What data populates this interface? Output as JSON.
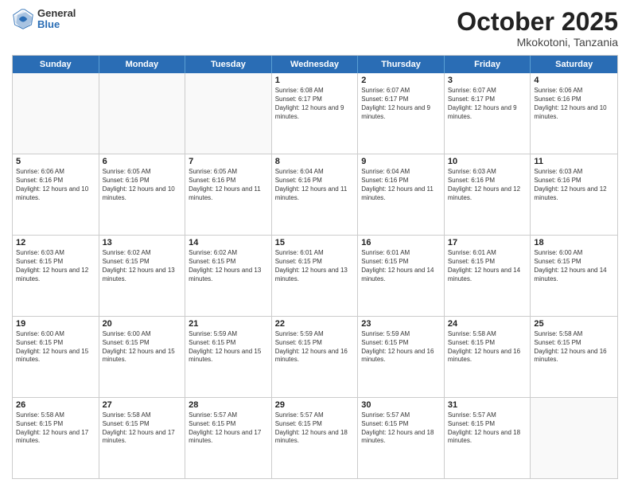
{
  "header": {
    "logo": {
      "general": "General",
      "blue": "Blue"
    },
    "title": "October 2025",
    "subtitle": "Mkokotoni, Tanzania"
  },
  "calendar": {
    "days_of_week": [
      "Sunday",
      "Monday",
      "Tuesday",
      "Wednesday",
      "Thursday",
      "Friday",
      "Saturday"
    ],
    "weeks": [
      [
        {
          "day": "",
          "empty": true
        },
        {
          "day": "",
          "empty": true
        },
        {
          "day": "",
          "empty": true
        },
        {
          "day": "1",
          "sunrise": "6:08 AM",
          "sunset": "6:17 PM",
          "daylight": "12 hours and 9 minutes."
        },
        {
          "day": "2",
          "sunrise": "6:07 AM",
          "sunset": "6:17 PM",
          "daylight": "12 hours and 9 minutes."
        },
        {
          "day": "3",
          "sunrise": "6:07 AM",
          "sunset": "6:17 PM",
          "daylight": "12 hours and 9 minutes."
        },
        {
          "day": "4",
          "sunrise": "6:06 AM",
          "sunset": "6:16 PM",
          "daylight": "12 hours and 10 minutes."
        }
      ],
      [
        {
          "day": "5",
          "sunrise": "6:06 AM",
          "sunset": "6:16 PM",
          "daylight": "12 hours and 10 minutes."
        },
        {
          "day": "6",
          "sunrise": "6:05 AM",
          "sunset": "6:16 PM",
          "daylight": "12 hours and 10 minutes."
        },
        {
          "day": "7",
          "sunrise": "6:05 AM",
          "sunset": "6:16 PM",
          "daylight": "12 hours and 11 minutes."
        },
        {
          "day": "8",
          "sunrise": "6:04 AM",
          "sunset": "6:16 PM",
          "daylight": "12 hours and 11 minutes."
        },
        {
          "day": "9",
          "sunrise": "6:04 AM",
          "sunset": "6:16 PM",
          "daylight": "12 hours and 11 minutes."
        },
        {
          "day": "10",
          "sunrise": "6:03 AM",
          "sunset": "6:16 PM",
          "daylight": "12 hours and 12 minutes."
        },
        {
          "day": "11",
          "sunrise": "6:03 AM",
          "sunset": "6:16 PM",
          "daylight": "12 hours and 12 minutes."
        }
      ],
      [
        {
          "day": "12",
          "sunrise": "6:03 AM",
          "sunset": "6:15 PM",
          "daylight": "12 hours and 12 minutes."
        },
        {
          "day": "13",
          "sunrise": "6:02 AM",
          "sunset": "6:15 PM",
          "daylight": "12 hours and 13 minutes."
        },
        {
          "day": "14",
          "sunrise": "6:02 AM",
          "sunset": "6:15 PM",
          "daylight": "12 hours and 13 minutes."
        },
        {
          "day": "15",
          "sunrise": "6:01 AM",
          "sunset": "6:15 PM",
          "daylight": "12 hours and 13 minutes."
        },
        {
          "day": "16",
          "sunrise": "6:01 AM",
          "sunset": "6:15 PM",
          "daylight": "12 hours and 14 minutes."
        },
        {
          "day": "17",
          "sunrise": "6:01 AM",
          "sunset": "6:15 PM",
          "daylight": "12 hours and 14 minutes."
        },
        {
          "day": "18",
          "sunrise": "6:00 AM",
          "sunset": "6:15 PM",
          "daylight": "12 hours and 14 minutes."
        }
      ],
      [
        {
          "day": "19",
          "sunrise": "6:00 AM",
          "sunset": "6:15 PM",
          "daylight": "12 hours and 15 minutes."
        },
        {
          "day": "20",
          "sunrise": "6:00 AM",
          "sunset": "6:15 PM",
          "daylight": "12 hours and 15 minutes."
        },
        {
          "day": "21",
          "sunrise": "5:59 AM",
          "sunset": "6:15 PM",
          "daylight": "12 hours and 15 minutes."
        },
        {
          "day": "22",
          "sunrise": "5:59 AM",
          "sunset": "6:15 PM",
          "daylight": "12 hours and 16 minutes."
        },
        {
          "day": "23",
          "sunrise": "5:59 AM",
          "sunset": "6:15 PM",
          "daylight": "12 hours and 16 minutes."
        },
        {
          "day": "24",
          "sunrise": "5:58 AM",
          "sunset": "6:15 PM",
          "daylight": "12 hours and 16 minutes."
        },
        {
          "day": "25",
          "sunrise": "5:58 AM",
          "sunset": "6:15 PM",
          "daylight": "12 hours and 16 minutes."
        }
      ],
      [
        {
          "day": "26",
          "sunrise": "5:58 AM",
          "sunset": "6:15 PM",
          "daylight": "12 hours and 17 minutes."
        },
        {
          "day": "27",
          "sunrise": "5:58 AM",
          "sunset": "6:15 PM",
          "daylight": "12 hours and 17 minutes."
        },
        {
          "day": "28",
          "sunrise": "5:57 AM",
          "sunset": "6:15 PM",
          "daylight": "12 hours and 17 minutes."
        },
        {
          "day": "29",
          "sunrise": "5:57 AM",
          "sunset": "6:15 PM",
          "daylight": "12 hours and 18 minutes."
        },
        {
          "day": "30",
          "sunrise": "5:57 AM",
          "sunset": "6:15 PM",
          "daylight": "12 hours and 18 minutes."
        },
        {
          "day": "31",
          "sunrise": "5:57 AM",
          "sunset": "6:15 PM",
          "daylight": "12 hours and 18 minutes."
        },
        {
          "day": "",
          "empty": true
        }
      ]
    ]
  }
}
